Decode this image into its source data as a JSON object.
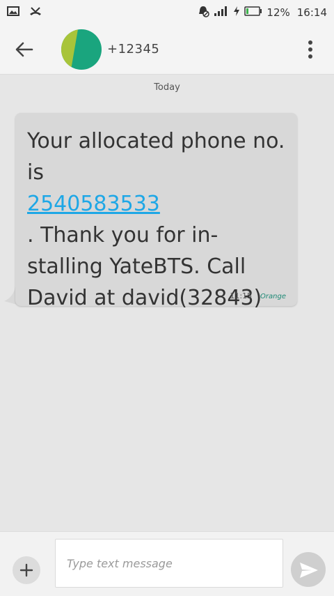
{
  "status_bar": {
    "icons_left": [
      "image-icon",
      "missed-call-icon"
    ],
    "icons_right": [
      "alarm-mute-icon",
      "signal-icon",
      "charging-icon",
      "battery-icon"
    ],
    "battery": "12%",
    "time": "16:14"
  },
  "header": {
    "title": "+12345",
    "avatar_colors": [
      "#1aa57e",
      "#a8c43a"
    ],
    "back_icon": "arrow-back-icon",
    "menu_icon": "more-vert-icon"
  },
  "conversation": {
    "date_divider": "Today",
    "message": {
      "text_before": "Your allocated phone no. is ",
      "phone_link": "2540583533",
      "text_after_head": ". Thank you for in-",
      "text_after_tail": "stalling YateBTS. Call David at david(32843)",
      "time": "11:15",
      "carrier": "Orange",
      "link_color": "#1ea7e6",
      "bubble_color": "#d8d8d8"
    }
  },
  "composer": {
    "placeholder": "Type text message",
    "value": "",
    "add_icon": "plus-icon",
    "send_icon": "send-icon"
  }
}
